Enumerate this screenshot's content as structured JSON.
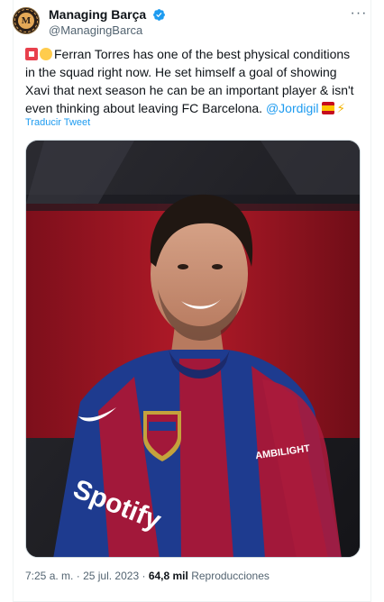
{
  "account": {
    "display_name": "Managing Barça",
    "handle": "@ManagingBarca",
    "avatar_letter": "M",
    "avatar_ring_text": "MANAGING BARÇA"
  },
  "tweet": {
    "text_main": "Ferran Torres has one of the best physical conditions in the squad right now. He set himself a goal of showing Xavi that next season he can be an important player & isn't even thinking about leaving FC Barcelona.",
    "mention": "@Jordigil",
    "translate_label": "Traducir Tweet"
  },
  "media": {
    "jersey_text_1": "AMBILIGHT",
    "jersey_text_2": "Spotify"
  },
  "meta": {
    "time": "7:25 a. m.",
    "separator": "·",
    "date": "25 jul. 2023",
    "views_count": "64,8 mil",
    "views_label": "Reproducciones"
  },
  "colors": {
    "link": "#1d9bf0",
    "verified": "#1d9bf0",
    "text": "#0f1419",
    "secondary": "#536471"
  },
  "icons": [
    "verified-badge-icon",
    "more-options-icon",
    "flag-emoji-icon",
    "smile-emoji-icon",
    "spain-flag-icon",
    "lightning-icon"
  ]
}
